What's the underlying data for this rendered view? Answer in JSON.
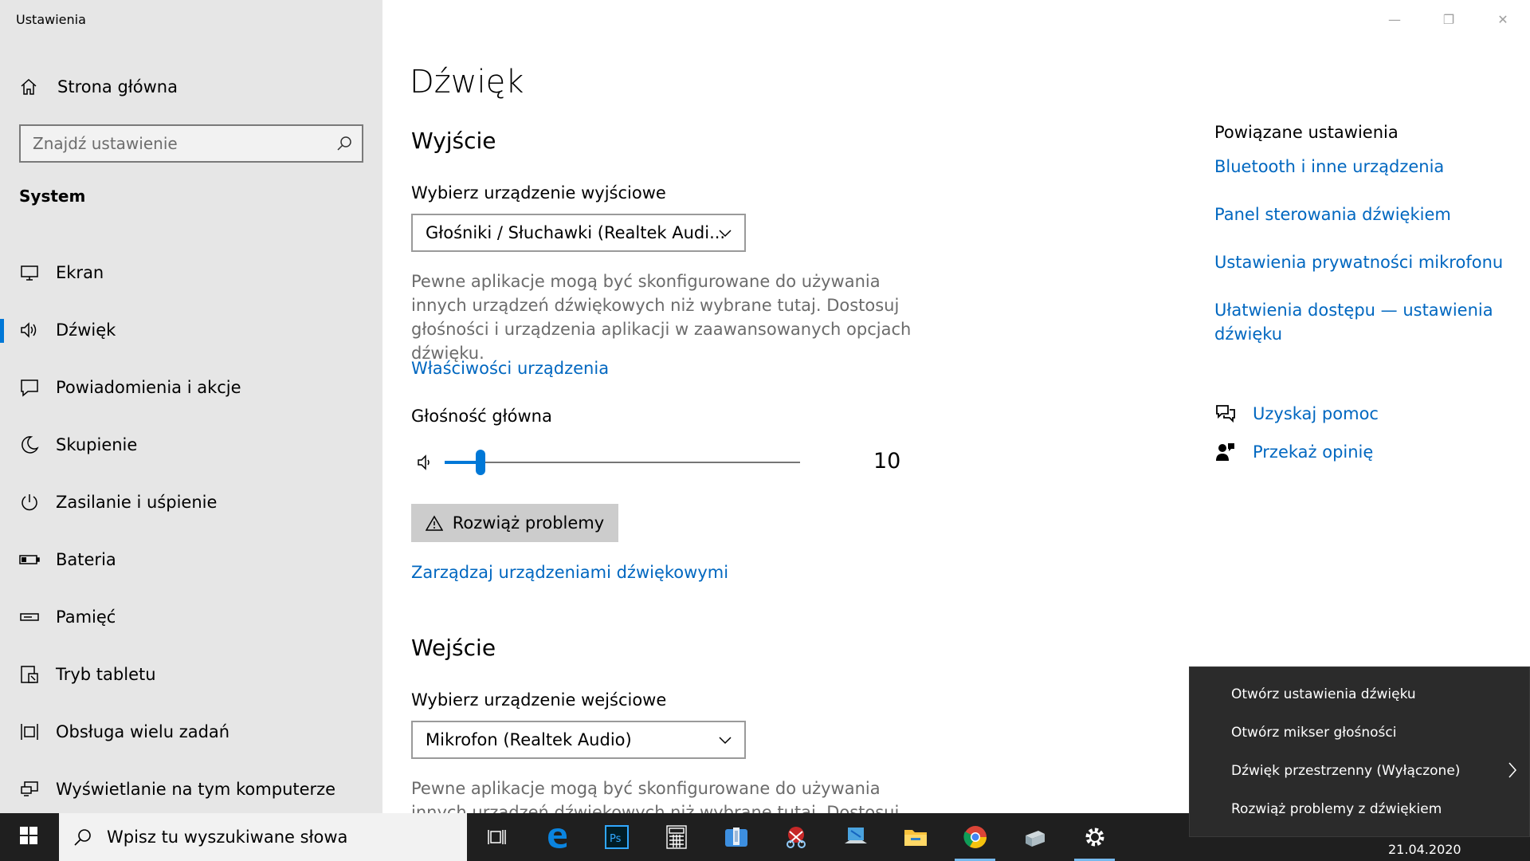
{
  "app": {
    "title": "Ustawienia"
  },
  "window_controls": {
    "minimize": "—",
    "restore": "❐",
    "close": "✕"
  },
  "sidebar": {
    "home_label": "Strona główna",
    "search_placeholder": "Znajdź ustawienie",
    "section": "System",
    "items": [
      {
        "label": "Ekran",
        "icon": "display-icon",
        "active": false
      },
      {
        "label": "Dźwięk",
        "icon": "speaker-icon",
        "active": true
      },
      {
        "label": "Powiadomienia i akcje",
        "icon": "notification-icon",
        "active": false
      },
      {
        "label": "Skupienie",
        "icon": "moon-icon",
        "active": false
      },
      {
        "label": "Zasilanie i uśpienie",
        "icon": "power-icon",
        "active": false
      },
      {
        "label": "Bateria",
        "icon": "battery-icon",
        "active": false
      },
      {
        "label": "Pamięć",
        "icon": "storage-icon",
        "active": false
      },
      {
        "label": "Tryb tabletu",
        "icon": "tablet-icon",
        "active": false
      },
      {
        "label": "Obsługa wielu zadań",
        "icon": "multitasking-icon",
        "active": false
      },
      {
        "label": "Wyświetlanie na tym komputerze",
        "icon": "projecting-icon",
        "active": false
      }
    ]
  },
  "main": {
    "title": "Dźwięk",
    "output": {
      "heading": "Wyjście",
      "device_label": "Wybierz urządzenie wyjściowe",
      "device_value": "Głośniki / Słuchawki (Realtek Audi...",
      "description": "Pewne aplikacje mogą być skonfigurowane do używania innych urządzeń dźwiękowych niż wybrane tutaj. Dostosuj głośności i urządzenia aplikacji w zaawansowanych opcjach dźwięku.",
      "properties_link": "Właściwości urządzenia",
      "volume_label": "Głośność główna",
      "volume_value": "10",
      "volume_level": 10,
      "troubleshoot": "Rozwiąż problemy",
      "manage_link": "Zarządzaj urządzeniami dźwiękowymi"
    },
    "input": {
      "heading": "Wejście",
      "device_label": "Wybierz urządzenie wejściowe",
      "device_value": "Mikrofon (Realtek Audio)",
      "description": "Pewne aplikacje mogą być skonfigurowane do używania innych urządzeń dźwiękowych niż wybrane tutaj. Dostosuj głośności i"
    }
  },
  "related": {
    "title": "Powiązane ustawienia",
    "links": [
      "Bluetooth i inne urządzenia",
      "Panel sterowania dźwiękiem",
      "Ustawienia prywatności mikrofonu",
      "Ułatwienia dostępu — ustawienia dźwięku"
    ],
    "help": "Uzyskaj pomoc",
    "feedback": "Przekaż opinię"
  },
  "context_menu": {
    "items": [
      "Otwórz ustawienia dźwięku",
      "Otwórz mikser głośności",
      "Dźwięk przestrzenny (Wyłączone)",
      "Rozwiąż problemy z dźwiękiem"
    ]
  },
  "taskbar": {
    "search_placeholder": "Wpisz tu wyszukiwane słowa",
    "date": "21.04.2020",
    "apps": [
      "task-view-icon",
      "edge-icon",
      "photoshop-icon",
      "calculator-icon",
      "files-icon",
      "snipping-icon",
      "laptop-icon",
      "file-explorer-icon",
      "chrome-icon",
      "device-icon",
      "settings-icon"
    ]
  },
  "colors": {
    "accent": "#0078d7",
    "link": "#0067c0",
    "sidebar_bg": "#e6e6e6",
    "taskbar_bg": "#1f1f1f"
  }
}
